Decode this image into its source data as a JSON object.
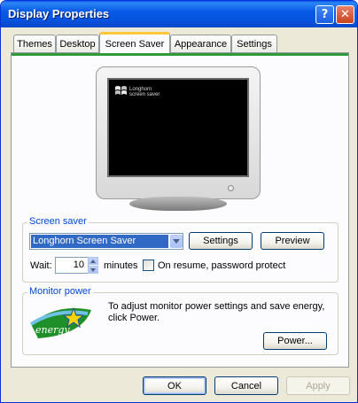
{
  "window": {
    "title": "Display Properties",
    "help_button": "?",
    "close_button": "✕"
  },
  "tabs": [
    {
      "label": "Themes",
      "active": false
    },
    {
      "label": "Desktop",
      "active": false
    },
    {
      "label": "Screen Saver",
      "active": true
    },
    {
      "label": "Appearance",
      "active": false
    },
    {
      "label": "Settings",
      "active": false
    }
  ],
  "preview": {
    "screen_line1": "Longhorn",
    "screen_line2": "screen saver"
  },
  "screen_saver": {
    "group_label": "Screen saver",
    "selected": "Longhorn Screen Saver",
    "settings_button": "Settings",
    "preview_button": "Preview",
    "wait_label": "Wait:",
    "wait_value": "10",
    "minutes_label": "minutes",
    "resume_label": "On resume, password protect",
    "resume_checked": false
  },
  "monitor_power": {
    "group_label": "Monitor power",
    "description": "To adjust monitor power settings and save energy, click Power.",
    "power_button": "Power...",
    "logo_text": "energy"
  },
  "footer": {
    "ok": "OK",
    "cancel": "Cancel",
    "apply": "Apply"
  },
  "colors": {
    "titlebar": "#0A5EE8",
    "active_tab_accent": "#FFC83C",
    "group_label": "#0046D5",
    "selection": "#316AC5"
  }
}
